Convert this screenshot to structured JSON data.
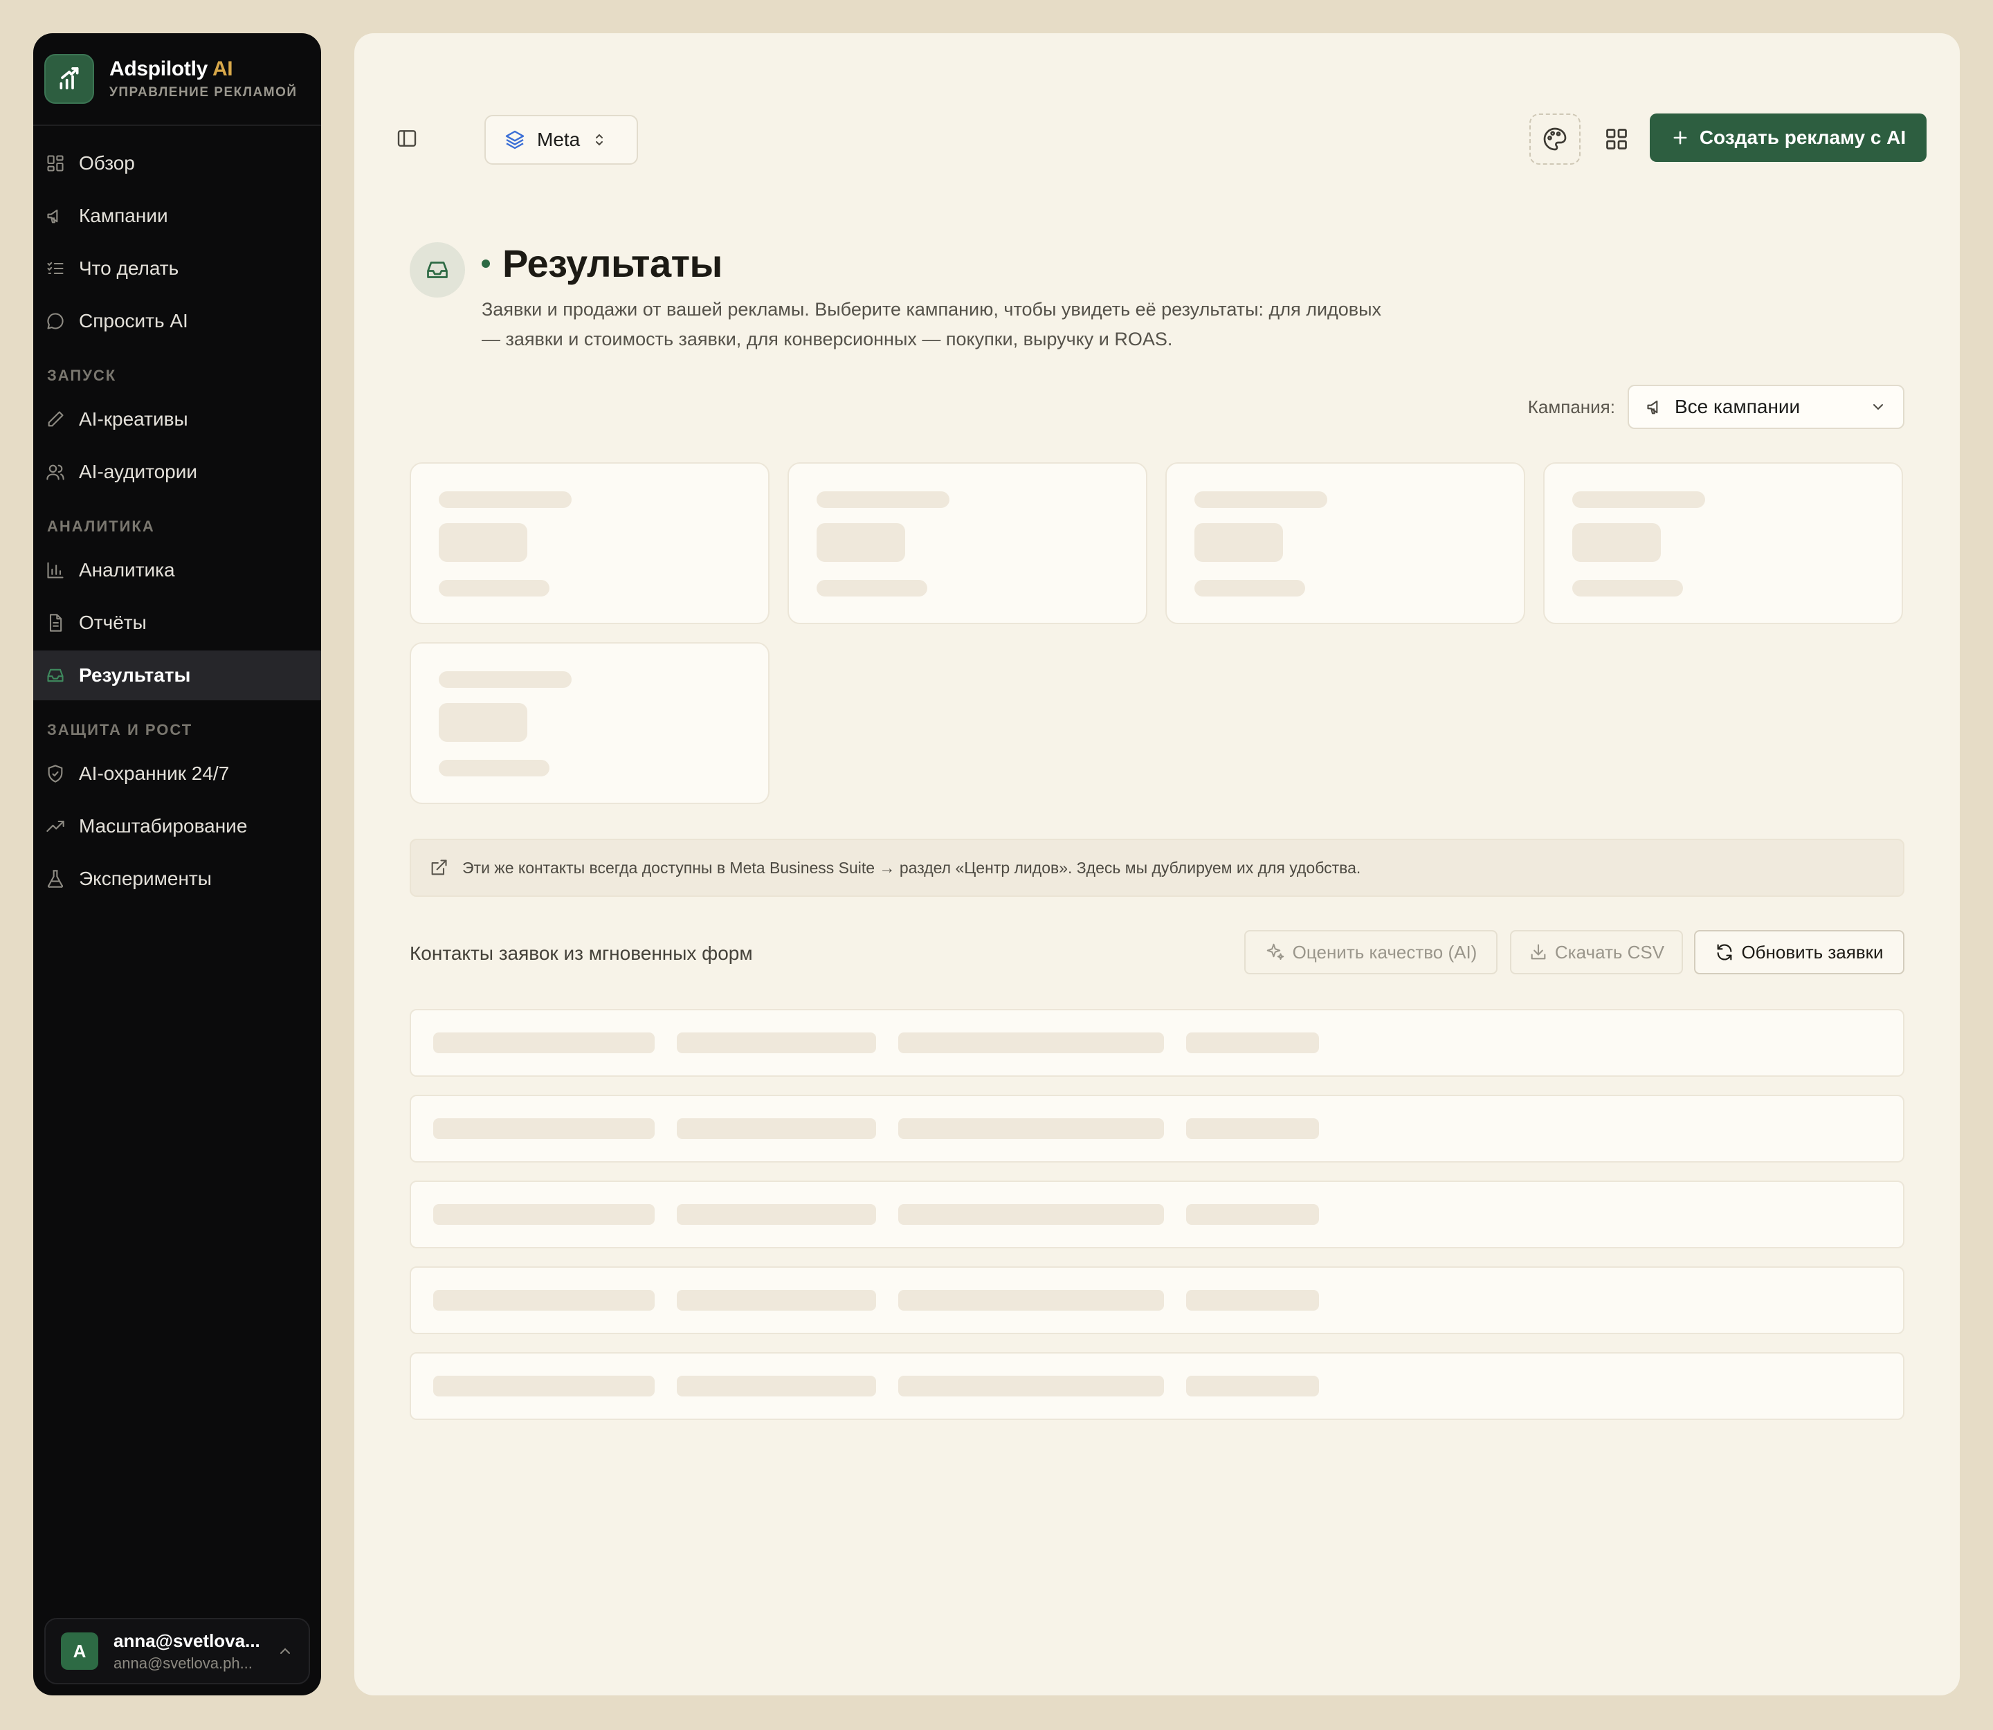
{
  "brand": {
    "name": "Adspilotly",
    "name_ai": "AI",
    "subtitle": "УПРАВЛЕНИЕ РЕКЛАМОЙ",
    "logo_icon": "bar-chart-arrow-icon",
    "accent_color": "#2d5e40"
  },
  "sidebar": {
    "items_main": [
      {
        "label": "Обзор",
        "icon": "dashboard-icon"
      },
      {
        "label": "Кампании",
        "icon": "megaphone-icon"
      },
      {
        "label": "Что делать",
        "icon": "checklist-icon"
      },
      {
        "label": "Спросить AI",
        "icon": "chat-bubble-icon"
      }
    ],
    "section_launch": "ЗАПУСК",
    "items_launch": [
      {
        "label": "AI-креативы",
        "icon": "pen-icon"
      },
      {
        "label": "AI-аудитории",
        "icon": "users-icon"
      }
    ],
    "section_analytics": "АНАЛИТИКА",
    "items_analytics": [
      {
        "label": "Аналитика",
        "icon": "bar-chart-icon"
      },
      {
        "label": "Отчёты",
        "icon": "document-icon"
      },
      {
        "label": "Результаты",
        "icon": "inbox-icon",
        "active": true
      }
    ],
    "section_growth": "ЗАЩИТА И РОСТ",
    "items_growth": [
      {
        "label": "AI-охранник 24/7",
        "icon": "shield-icon"
      },
      {
        "label": "Масштабирование",
        "icon": "trending-up-icon"
      },
      {
        "label": "Эксперименты",
        "icon": "flask-icon"
      }
    ]
  },
  "user": {
    "initial": "A",
    "name": "anna@svetlova...",
    "email": "anna@svetlova.ph..."
  },
  "topbar": {
    "platform": "Meta",
    "create_button": "Создать рекламу с AI"
  },
  "page": {
    "title": "Результаты",
    "description": "Заявки и продажи от вашей рекламы. Выберите кампанию, чтобы увидеть её результаты: для лидовых — заявки и стоимость заявки, для конверсионных — покупки, выручку и ROAS."
  },
  "campaign_filter": {
    "label": "Кампания:",
    "value": "Все кампании"
  },
  "info_banner": {
    "text": "Эти же контакты всегда доступны в Meta Business Suite → раздел «Центр лидов». Здесь мы дублируем их для удобства."
  },
  "leads": {
    "title": "Контакты заявок из мгновенных форм",
    "buttons": {
      "rate": "Оценить качество (AI)",
      "download": "Скачать CSV",
      "refresh": "Обновить заявки"
    }
  },
  "loading_state": {
    "stat_card_placeholders": 5,
    "row_placeholders": 5
  }
}
